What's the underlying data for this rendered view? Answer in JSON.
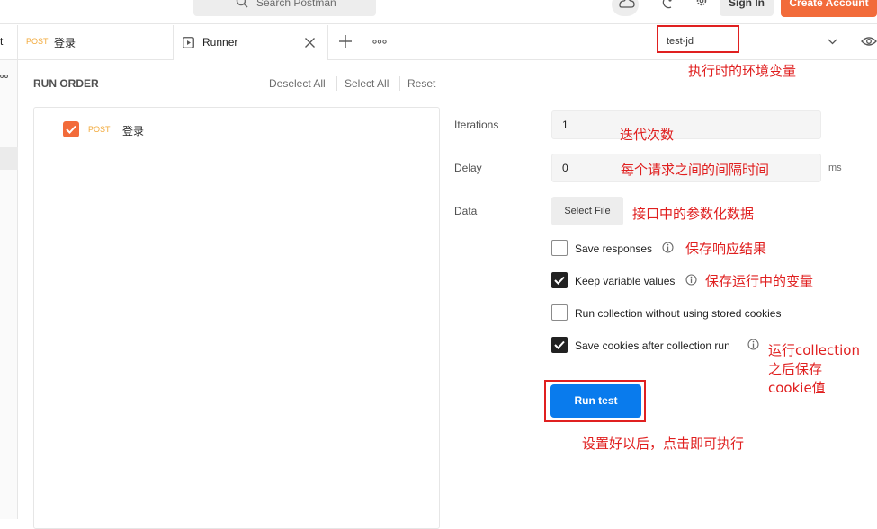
{
  "top_bar": {
    "search_placeholder": "Search Postman",
    "sign_in_label": "Sign In",
    "create_account_label": "Create Account"
  },
  "tabs": {
    "left_stub_text": "t",
    "login_method": "POST",
    "login_label": "登录",
    "runner_label": "Runner"
  },
  "environment": {
    "selected": "test-jd"
  },
  "run_order": {
    "title": "RUN ORDER",
    "deselect_all": "Deselect All",
    "select_all": "Select All",
    "reset": "Reset",
    "requests": [
      {
        "method": "POST",
        "name": "登录",
        "checked": true
      }
    ]
  },
  "settings": {
    "iterations_label": "Iterations",
    "iterations_value": "1",
    "delay_label": "Delay",
    "delay_value": "0",
    "delay_unit": "ms",
    "data_label": "Data",
    "select_file_label": "Select File",
    "options": [
      {
        "label": "Save responses",
        "checked": false,
        "info": true
      },
      {
        "label": "Keep variable values",
        "checked": true,
        "info": true
      },
      {
        "label": "Run collection without using stored cookies",
        "checked": false,
        "info": false
      },
      {
        "label": "Save cookies after collection run",
        "checked": true,
        "info": true
      }
    ],
    "run_button_label": "Run test"
  },
  "annotations": {
    "env": "执行时的环境变量",
    "iterations": "迭代次数",
    "delay": "每个请求之间的间隔时间",
    "data": "接口中的参数化数据",
    "save_responses": "保存响应结果",
    "keep_vars": "保存运行中的变量",
    "save_cookies_line1": "运行collection",
    "save_cookies_line2": "之后保存",
    "save_cookies_line3": "cookie值",
    "run": "设置好以后，点击即可执行"
  },
  "colors": {
    "accent_orange": "#f26b3a",
    "run_blue": "#097bed",
    "annotation_red": "#e02020",
    "post_method": "#f2a93a"
  }
}
